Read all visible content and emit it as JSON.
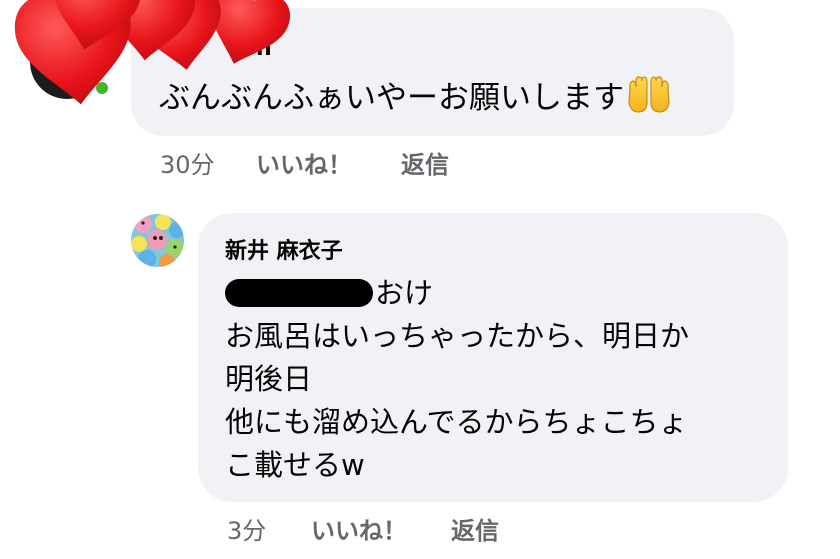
{
  "colors": {
    "bubble": "#f0f2f5",
    "meta_text": "#65676b",
    "online": "#42b72a",
    "heart": "#e8151b"
  },
  "comment_top": {
    "author_tail": "n",
    "text": "ぶんぶんふぁいやーお願いします",
    "emoji": "palms-up-together-icon",
    "time": "30分",
    "like_label": "いいね！",
    "reply_label": "返信"
  },
  "reply": {
    "author": "新井 麻衣子",
    "lines": [
      "おけ",
      "お風呂はいっちゃったから、明日か",
      "明後日",
      "他にも溜め込んでるからちょこちょ",
      "こ載せるw"
    ],
    "time": "3分",
    "like_label": "いいね！",
    "reply_label": "返信"
  },
  "overlay": {
    "icon": "hearts-icon"
  }
}
